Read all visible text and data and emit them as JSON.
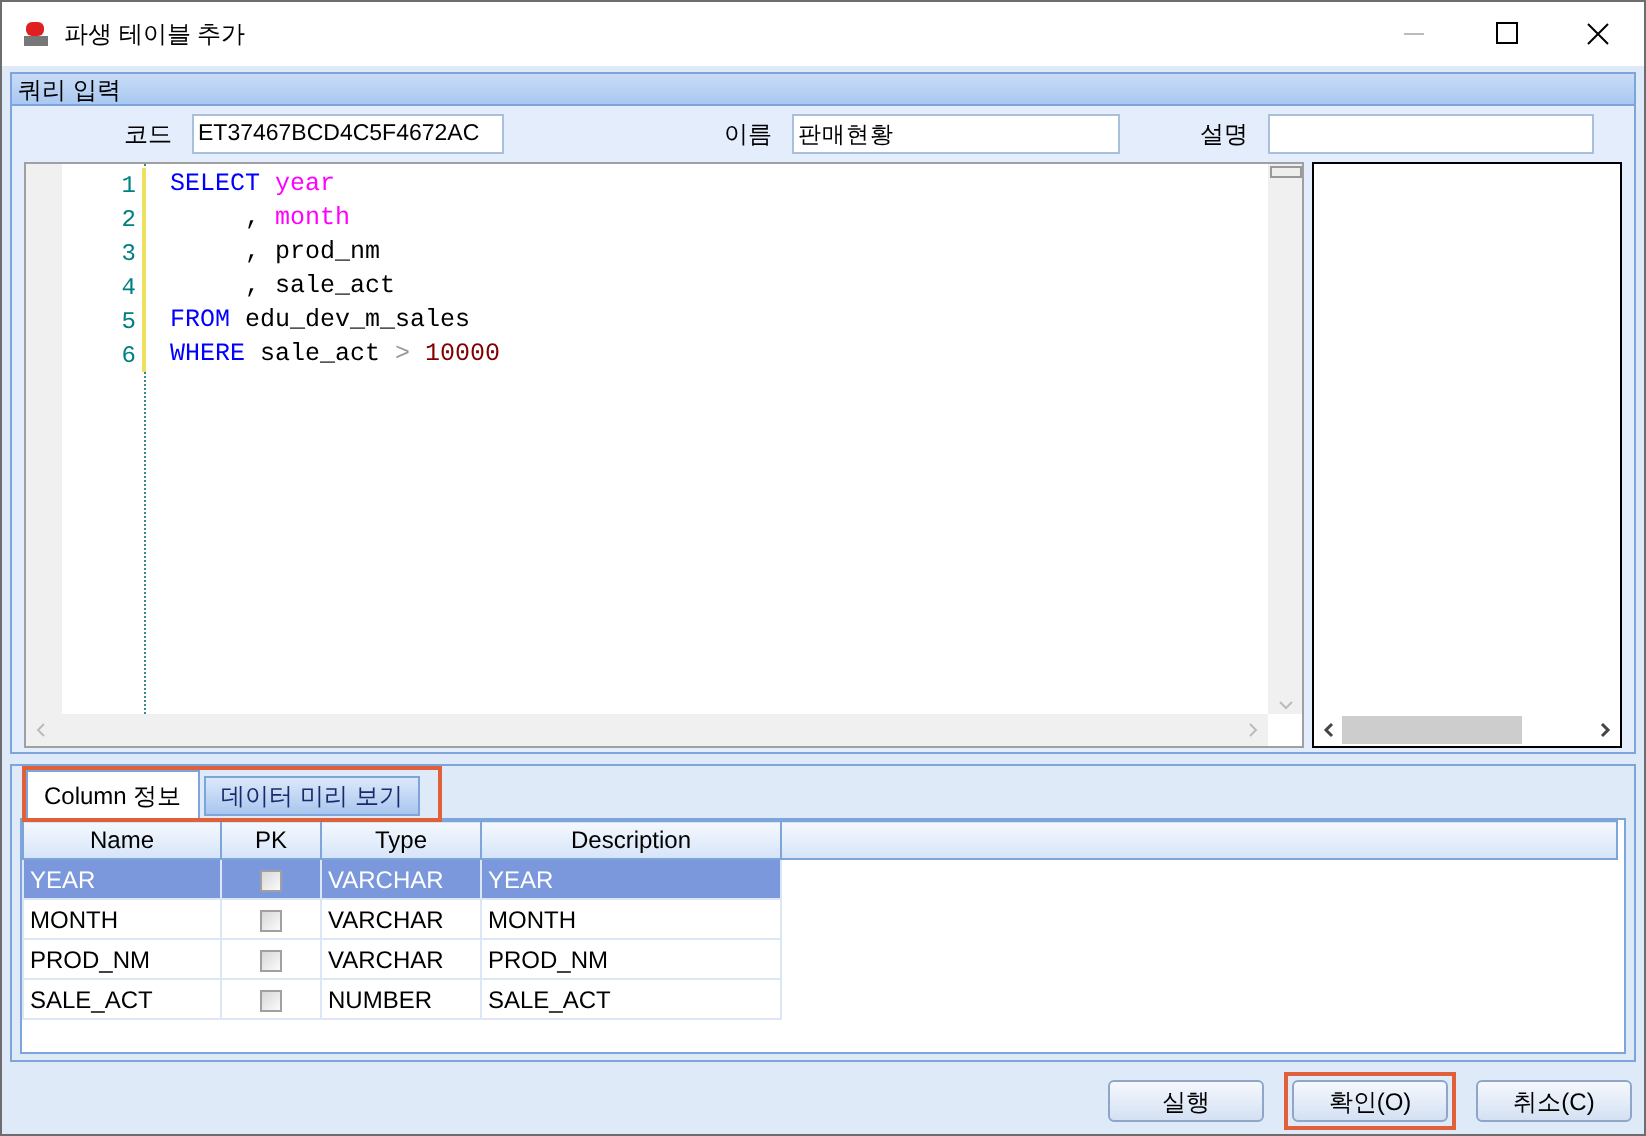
{
  "window": {
    "title": "파생 테이블 추가"
  },
  "query_panel": {
    "title": "쿼리 입력",
    "fields": [
      {
        "label": "코드",
        "value": "ET37467BCD4C5F4672AC"
      },
      {
        "label": "이름",
        "value": "판매현황"
      },
      {
        "label": "설명"
      }
    ],
    "code_lines": [
      {
        "number": "1",
        "tokens": [
          {
            "kind": "keyword",
            "text": "SELECT "
          },
          {
            "kind": "column",
            "text": "year"
          }
        ]
      },
      {
        "number": "2",
        "tokens": [
          {
            "kind": "plain",
            "text": "     , "
          },
          {
            "kind": "column",
            "text": "month"
          }
        ]
      },
      {
        "number": "3",
        "tokens": [
          {
            "kind": "plain",
            "text": "     , prod_nm"
          }
        ]
      },
      {
        "number": "4",
        "tokens": [
          {
            "kind": "plain",
            "text": "     , sale_act"
          }
        ]
      },
      {
        "number": "5",
        "tokens": [
          {
            "kind": "keyword",
            "text": "FROM "
          },
          {
            "kind": "plain",
            "text": "edu_dev_m_sales"
          }
        ]
      },
      {
        "number": "6",
        "tokens": [
          {
            "kind": "keyword",
            "text": "WHERE "
          },
          {
            "kind": "plain",
            "text": "sale_act "
          },
          {
            "kind": "operator",
            "text": "> "
          },
          {
            "kind": "number",
            "text": "10000"
          }
        ]
      }
    ]
  },
  "tabs_highlighted": true,
  "tabs": [
    {
      "label": "Column 정보",
      "selected": true
    },
    {
      "label": "데이터 미리 보기",
      "selected": false
    }
  ],
  "table": {
    "columns": [
      "Name",
      "PK",
      "Type",
      "Description"
    ],
    "rows": [
      {
        "name": "YEAR",
        "pk": false,
        "type": "VARCHAR",
        "description": "YEAR",
        "selected": true
      },
      {
        "name": "MONTH",
        "pk": false,
        "type": "VARCHAR",
        "description": "MONTH",
        "selected": false
      },
      {
        "name": "PROD_NM",
        "pk": false,
        "type": "VARCHAR",
        "description": "PROD_NM",
        "selected": false
      },
      {
        "name": "SALE_ACT",
        "pk": false,
        "type": "NUMBER",
        "description": "SALE_ACT",
        "selected": false
      }
    ]
  },
  "buttons": [
    {
      "label": "실행",
      "highlighted": false
    },
    {
      "label": "확인(O)",
      "highlighted": true
    },
    {
      "label": "취소(C)",
      "highlighted": false
    }
  ]
}
